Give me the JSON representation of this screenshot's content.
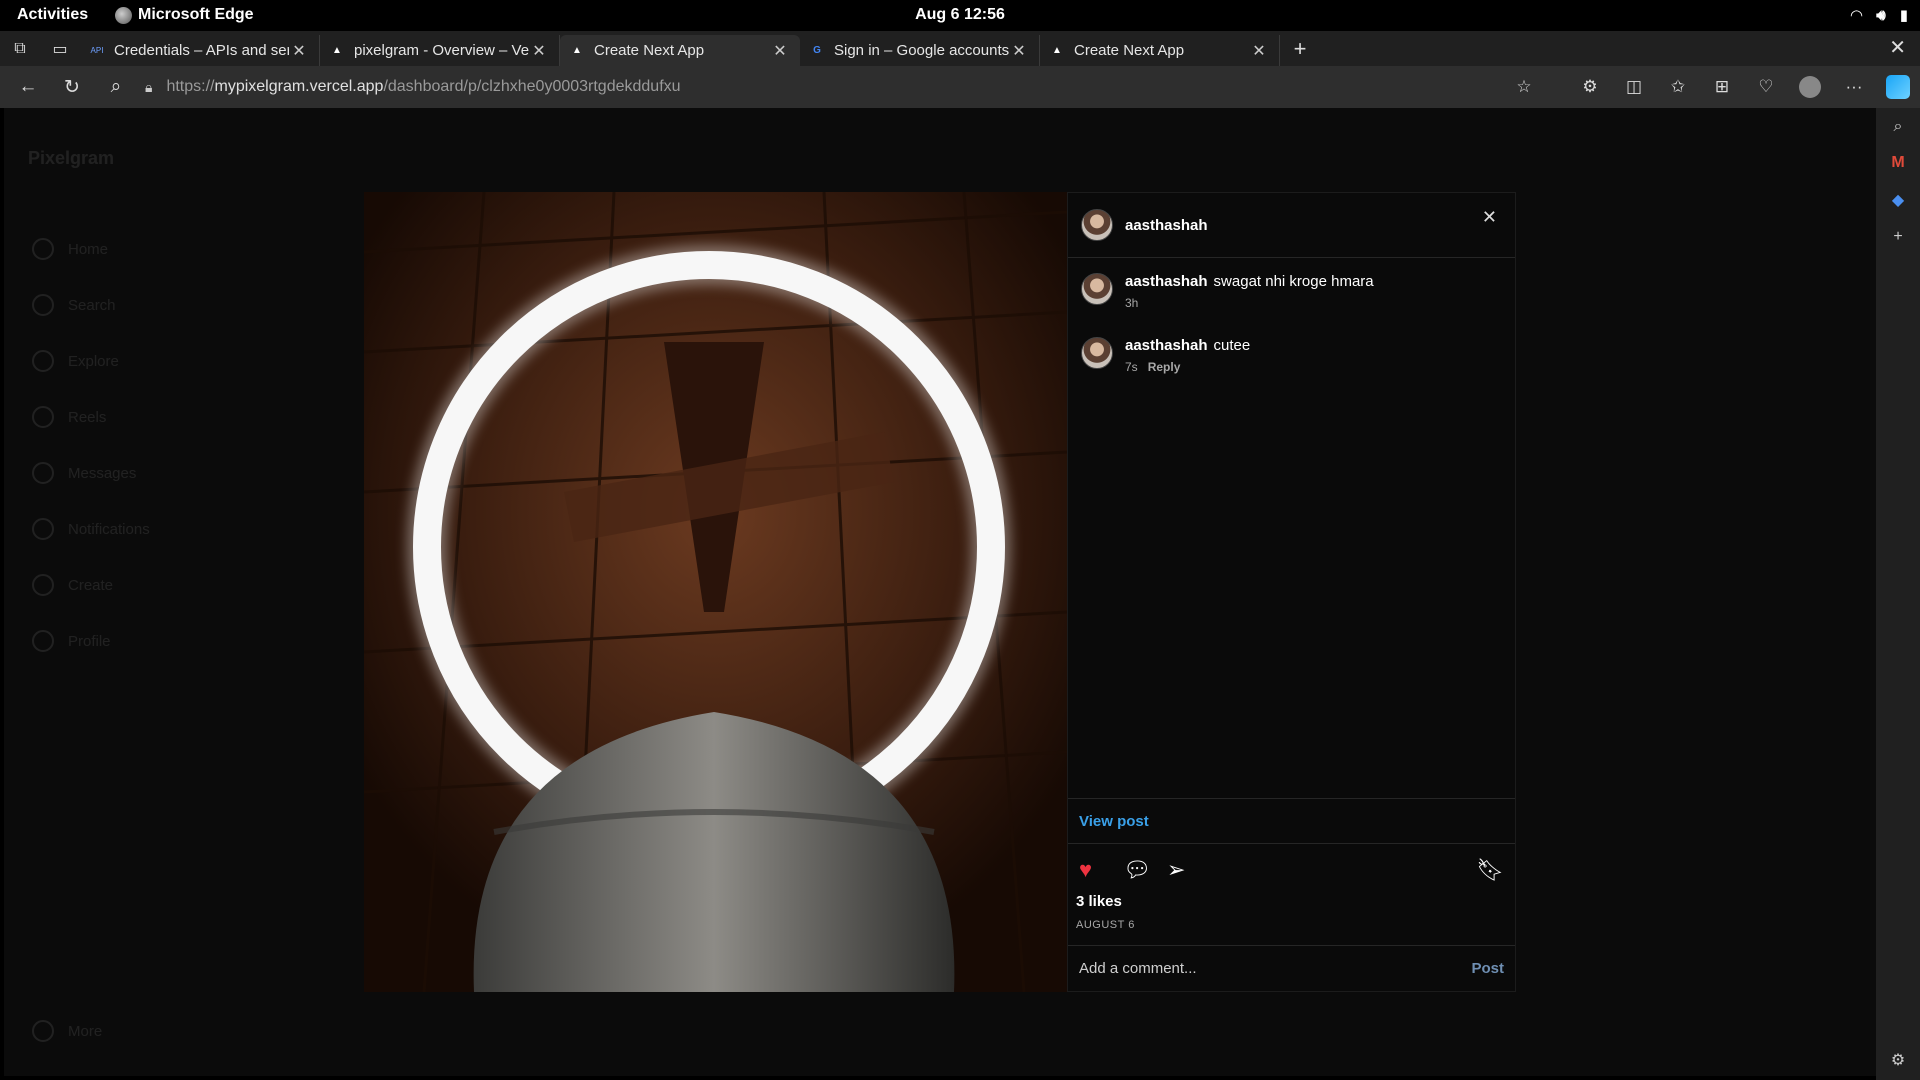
{
  "system": {
    "activities": "Activities",
    "app_name": "Microsoft Edge",
    "clock": "Aug 6  12:56"
  },
  "tabs": [
    {
      "title": "Credentials – APIs and ser",
      "favicon": "api-icon",
      "active": false
    },
    {
      "title": "pixelgram - Overview – Ve",
      "favicon": "vercel-icon",
      "active": false
    },
    {
      "title": "Create Next App",
      "favicon": "vercel-icon",
      "active": true
    },
    {
      "title": "Sign in – Google accounts",
      "favicon": "google-icon",
      "active": false
    },
    {
      "title": "Create Next App",
      "favicon": "vercel-icon",
      "active": false
    }
  ],
  "address": {
    "scheme": "https://",
    "host": "mypixelgram.vercel.app",
    "path": "/dashboard/p/clzhxhe0y0003rtgdekddufxu"
  },
  "background_app": {
    "logo": "Pixelgram",
    "nav": [
      "Home",
      "Search",
      "Explore",
      "Reels",
      "Messages",
      "Notifications",
      "Create",
      "Profile"
    ],
    "more": "More"
  },
  "post": {
    "author": "aasthashah",
    "comments": [
      {
        "user": "aasthashah",
        "text": "swagat nhi kroge hmara",
        "time": "3h",
        "reply": ""
      },
      {
        "user": "aasthashah",
        "text": "cutee",
        "time": "7s",
        "reply": "Reply"
      }
    ],
    "view_post": "View post",
    "likes": "3 likes",
    "date": "AUGUST 6",
    "comment_placeholder": "Add a comment...",
    "post_label": "Post",
    "liked": true
  },
  "colors": {
    "accent_link": "#3aa0e8",
    "heart": "#ef3340"
  }
}
